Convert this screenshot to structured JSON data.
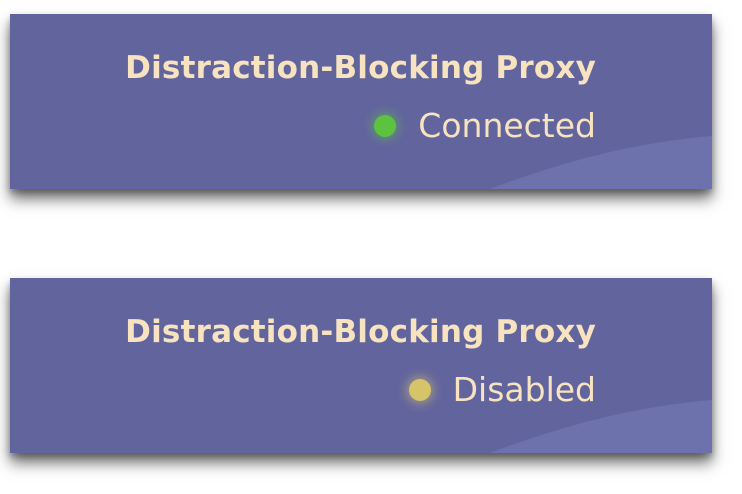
{
  "cards": [
    {
      "title": "Distraction-Blocking Proxy",
      "status": "Connected",
      "status_color": "#5cc33f"
    },
    {
      "title": "Distraction-Blocking Proxy",
      "status": "Disabled",
      "status_color": "#d6c46a"
    }
  ],
  "colors": {
    "card_background": "#62649e",
    "wave": "#7076b0",
    "text": "#f7e3bf"
  },
  "icons": [
    "status-dot-icon"
  ]
}
